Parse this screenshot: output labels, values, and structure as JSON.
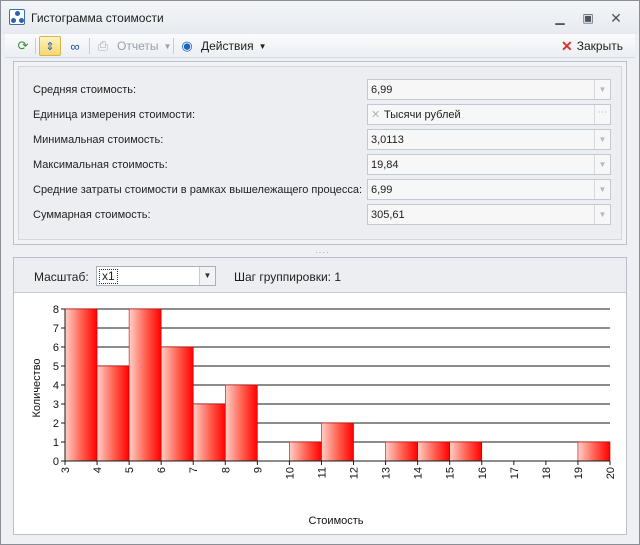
{
  "window": {
    "title": "Гистограмма стоимости"
  },
  "toolbar": {
    "reports_label": "Отчеты",
    "actions_label": "Действия",
    "close_label": "Закрыть"
  },
  "properties": [
    {
      "label": "Средняя стоимость:",
      "value": "6,99"
    },
    {
      "label": "Единица измерения стоимости:",
      "value": "Тысячи рублей"
    },
    {
      "label": "Минимальная стоимость:",
      "value": "3,0113"
    },
    {
      "label": "Максимальная стоимость:",
      "value": "19,84"
    },
    {
      "label": "Средние затраты стоимости в рамках вышележащего процесса:",
      "value": "6,99"
    },
    {
      "label": "Суммарная стоимость:",
      "value": "305,61"
    }
  ],
  "scale": {
    "label": "Масштаб:",
    "value": "x1",
    "group_label": "Шаг группировки:",
    "group_value": "1"
  },
  "chart_data": {
    "type": "bar",
    "xlabel": "Стоимость",
    "ylabel": "Количество",
    "x_ticks": [
      "3",
      "4",
      "5",
      "6",
      "7",
      "8",
      "9",
      "10",
      "11",
      "12",
      "13",
      "14",
      "15",
      "16",
      "17",
      "18",
      "19",
      "20"
    ],
    "y_ticks": [
      "0",
      "1",
      "2",
      "3",
      "4",
      "5",
      "6",
      "7",
      "8"
    ],
    "bins": [
      {
        "from": 3,
        "to": 4,
        "count": 8
      },
      {
        "from": 4,
        "to": 5,
        "count": 5
      },
      {
        "from": 5,
        "to": 6,
        "count": 8
      },
      {
        "from": 6,
        "to": 7,
        "count": 6
      },
      {
        "from": 7,
        "to": 8,
        "count": 3
      },
      {
        "from": 8,
        "to": 9,
        "count": 4
      },
      {
        "from": 9,
        "to": 10,
        "count": 0
      },
      {
        "from": 10,
        "to": 11,
        "count": 1
      },
      {
        "from": 11,
        "to": 12,
        "count": 2
      },
      {
        "from": 12,
        "to": 13,
        "count": 0
      },
      {
        "from": 13,
        "to": 14,
        "count": 1
      },
      {
        "from": 14,
        "to": 15,
        "count": 1
      },
      {
        "from": 15,
        "to": 16,
        "count": 1
      },
      {
        "from": 16,
        "to": 17,
        "count": 0
      },
      {
        "from": 17,
        "to": 18,
        "count": 0
      },
      {
        "from": 18,
        "to": 19,
        "count": 0
      },
      {
        "from": 19,
        "to": 20,
        "count": 1
      }
    ],
    "xlim": [
      3,
      20
    ],
    "ylim": [
      0,
      8
    ],
    "grid": true,
    "colors": {
      "bar_dark": "#ff0000",
      "bar_light": "#ffd0c8"
    }
  }
}
